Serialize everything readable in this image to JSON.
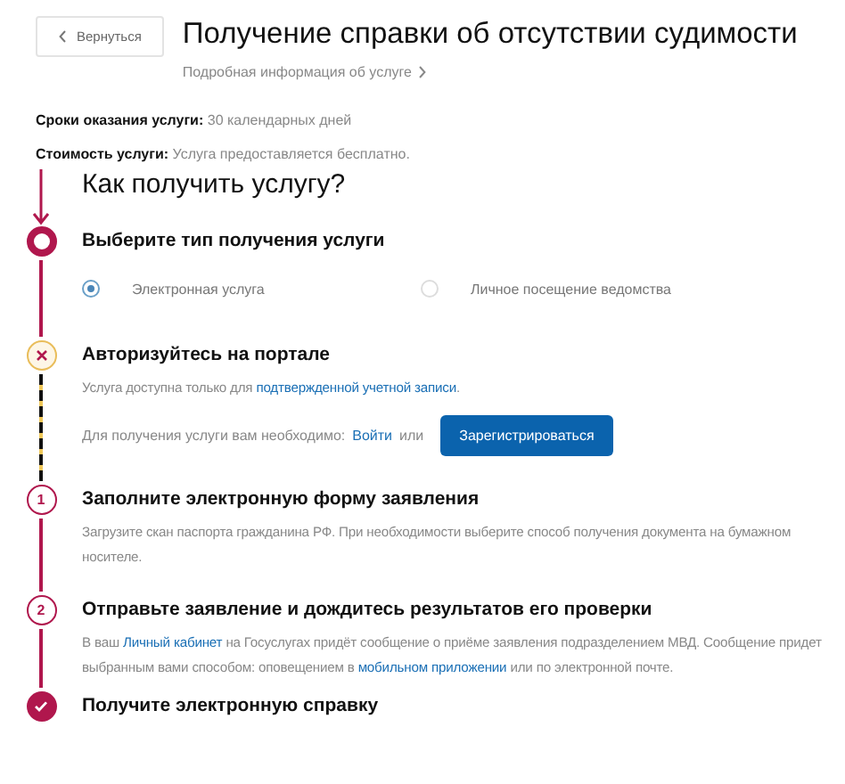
{
  "back_button": {
    "label": "Вернуться"
  },
  "title": "Получение справки об отсутствии судимости",
  "details_link": "Подробная информация об услуге",
  "info": [
    {
      "label": "Сроки оказания услуги:",
      "value": "30 календарных дней"
    },
    {
      "label": "Стоимость услуги:",
      "value": "Услуга предоставляется бесплатно."
    }
  ],
  "howto": {
    "heading": "Как получить услугу?",
    "steps": [
      {
        "kind": "current",
        "title": "Выберите тип получения услуги",
        "options": [
          {
            "label": "Электронная услуга",
            "selected": true
          },
          {
            "label": "Личное посещение ведомства",
            "selected": false
          }
        ]
      },
      {
        "kind": "error",
        "title": "Авторизуйтесь на портале",
        "text": [
          {
            "text": "Услуга доступна только для ",
            "link": false
          },
          {
            "text": "подтвержденной учетной записи",
            "link": true
          },
          {
            "text": ".",
            "link": false
          }
        ],
        "action": {
          "text": "Для получения услуги вам необходимо:",
          "link": "Войти",
          "joiner": "или",
          "button": "Зарегистрироваться"
        }
      },
      {
        "kind": "number",
        "number": "1",
        "title": "Заполните электронную форму заявления",
        "text": [
          {
            "text": "Загрузите скан паспорта гражданина РФ. При необходимости выберите способ получения документа на бумажном носителе.",
            "link": false
          }
        ]
      },
      {
        "kind": "number",
        "number": "2",
        "title": "Отправьте заявление и дождитесь результатов его проверки",
        "text": [
          {
            "text": "В ваш ",
            "link": false
          },
          {
            "text": "Личный кабинет",
            "link": true
          },
          {
            "text": " на Госуслугах придёт сообщение о приёме заявления подразделением МВД. Сообщение придет выбранным вами способом: оповещением в ",
            "link": false
          },
          {
            "text": "мобильном приложении",
            "link": true
          },
          {
            "text": " или по электронной почте.",
            "link": false
          }
        ]
      },
      {
        "kind": "done",
        "title": "Получите электронную справку"
      }
    ]
  }
}
